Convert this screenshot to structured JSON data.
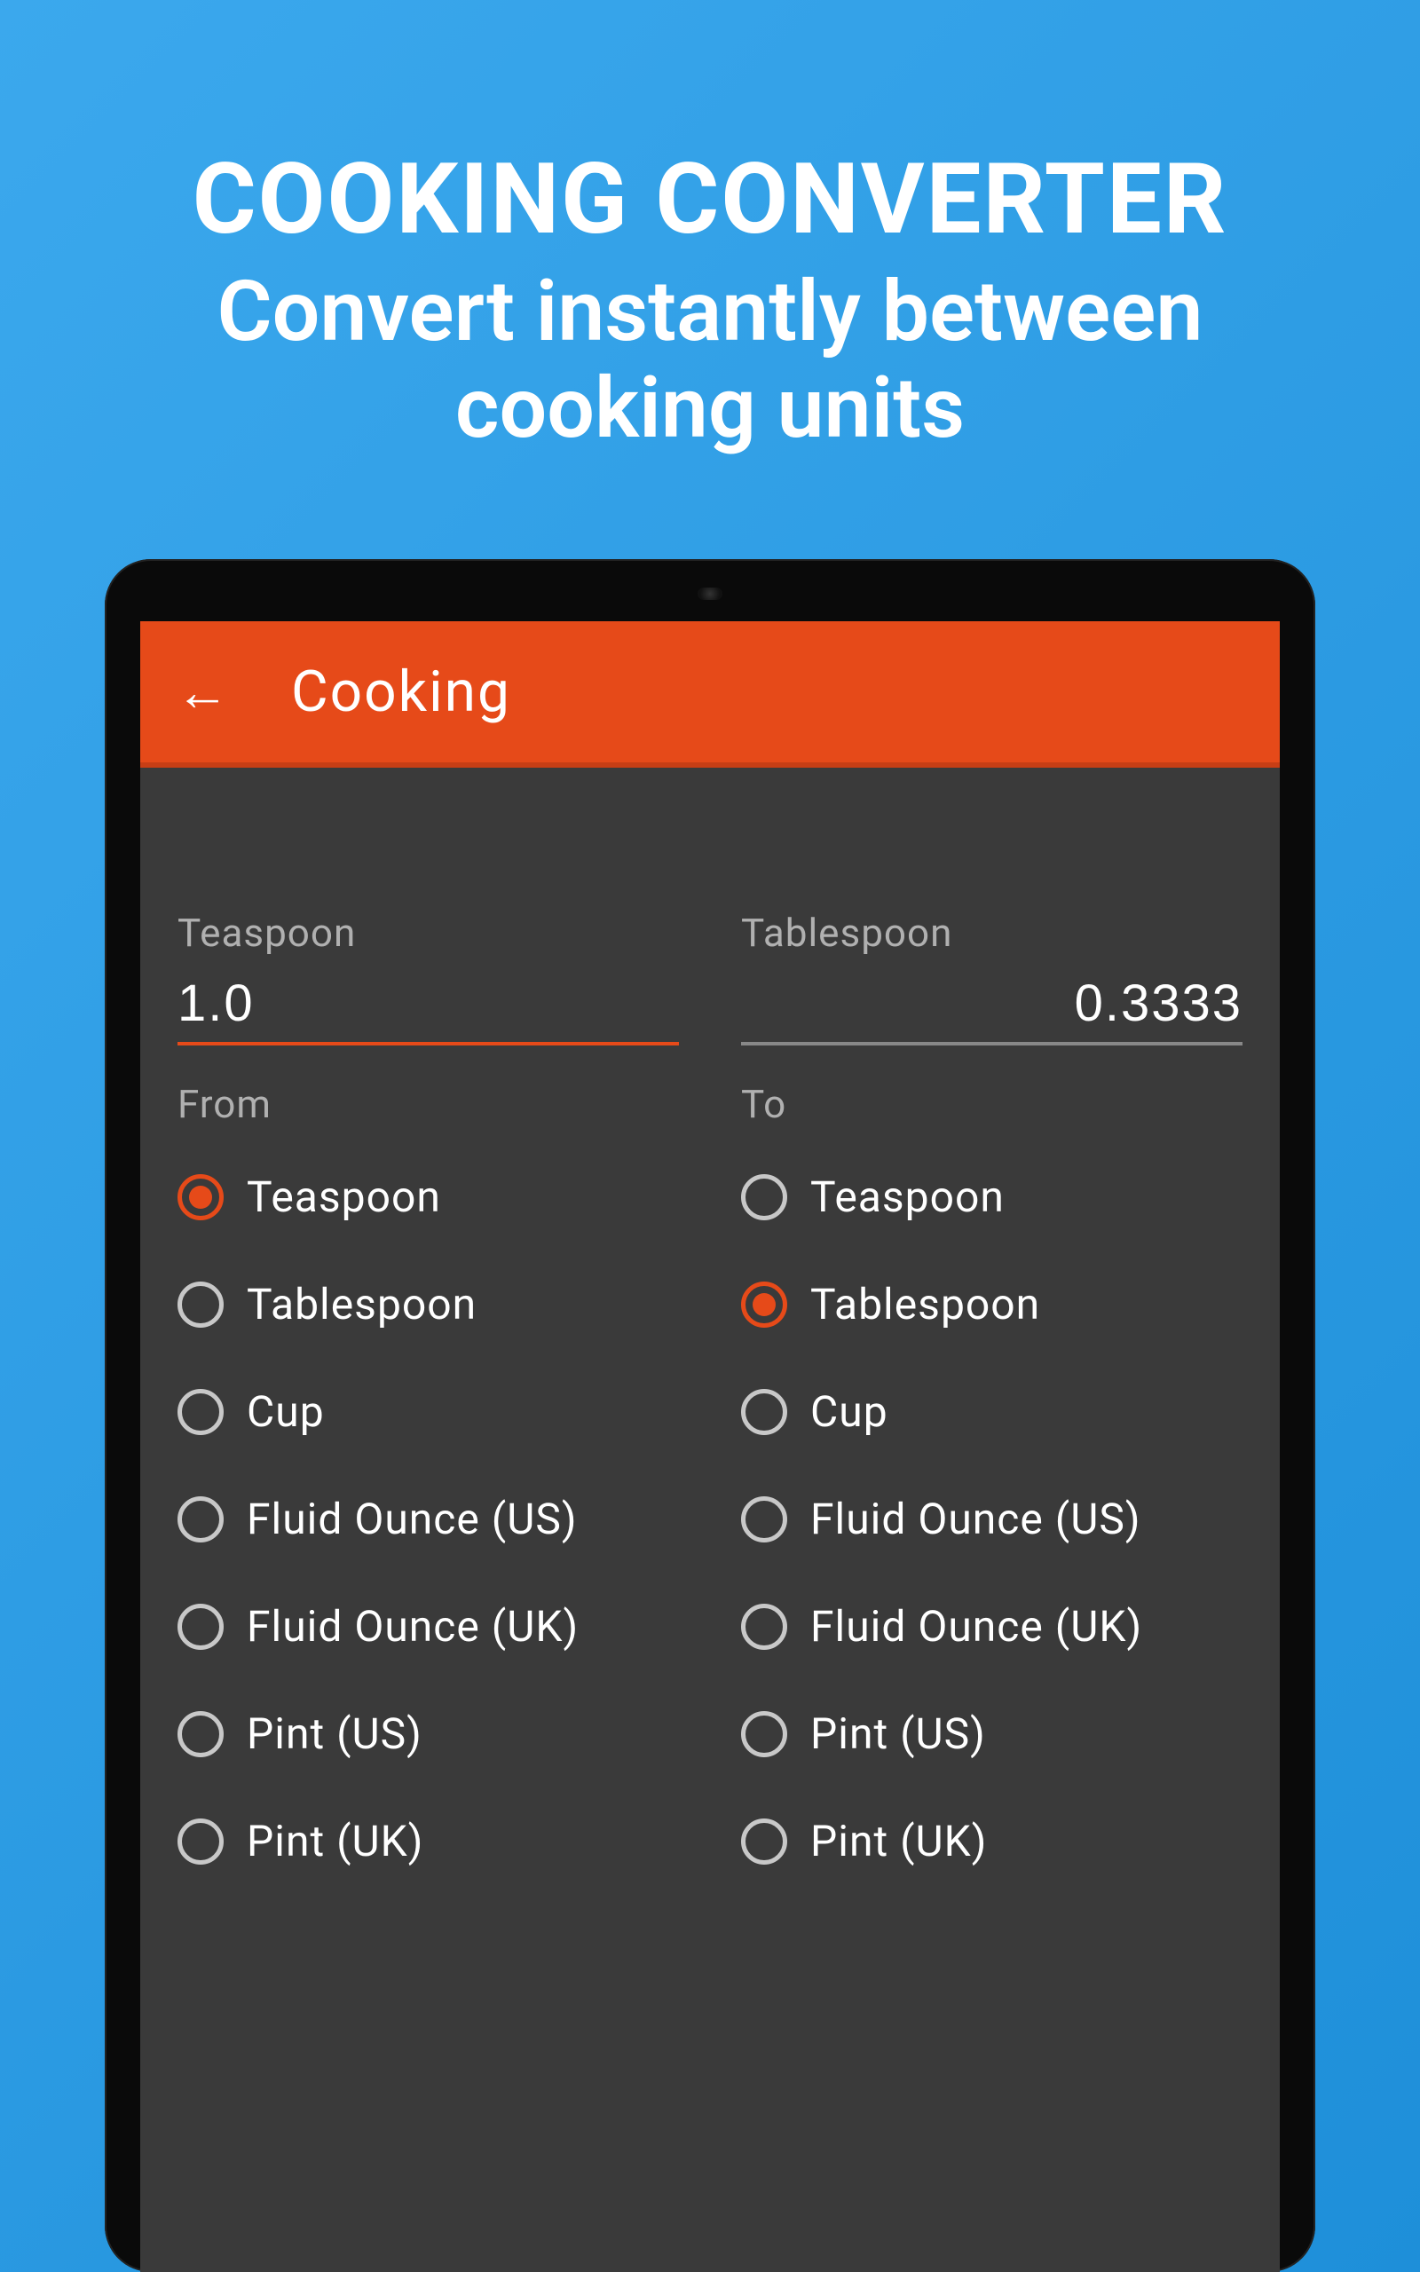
{
  "hero": {
    "title": "COOKING CONVERTER",
    "subtitle_line1": "Convert instantly between",
    "subtitle_line2": "cooking units"
  },
  "app": {
    "title": "Cooking",
    "left": {
      "label": "Teaspoon",
      "value": "1.0",
      "section": "From"
    },
    "right": {
      "label": "Tablespoon",
      "value": "0.3333",
      "section": "To"
    },
    "units": [
      "Teaspoon",
      "Tablespoon",
      "Cup",
      "Fluid Ounce (US)",
      "Fluid Ounce (UK)",
      "Pint (US)",
      "Pint (UK)"
    ],
    "from_selected": 0,
    "to_selected": 1
  }
}
